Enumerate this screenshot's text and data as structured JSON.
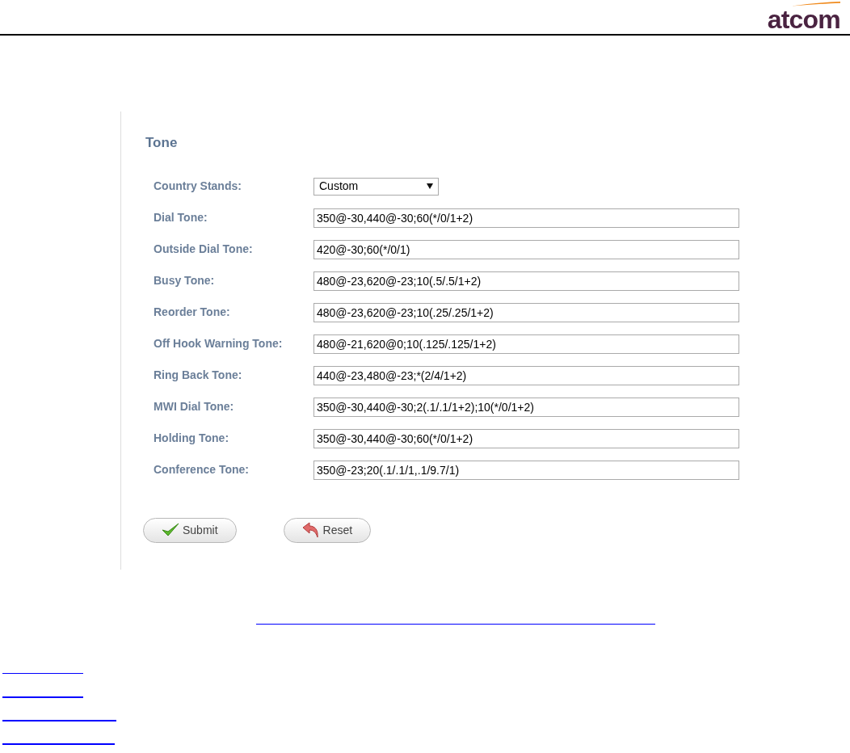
{
  "header": {
    "logo": "atcom"
  },
  "form": {
    "title": "Tone",
    "fields": [
      {
        "kind": "select",
        "label": "Country Stands:",
        "value": "Custom"
      },
      {
        "kind": "text",
        "label": "Dial Tone:",
        "value": "350@-30,440@-30;60(*/0/1+2)"
      },
      {
        "kind": "text",
        "label": "Outside Dial Tone:",
        "value": "420@-30;60(*/0/1)"
      },
      {
        "kind": "text",
        "label": "Busy Tone:",
        "value": "480@-23,620@-23;10(.5/.5/1+2)"
      },
      {
        "kind": "text",
        "label": "Reorder Tone:",
        "value": "480@-23,620@-23;10(.25/.25/1+2)"
      },
      {
        "kind": "text",
        "label": "Off Hook Warning Tone:",
        "value": "480@-21,620@0;10(.125/.125/1+2)"
      },
      {
        "kind": "text",
        "label": "Ring Back Tone:",
        "value": "440@-23,480@-23;*(2/4/1+2)"
      },
      {
        "kind": "text",
        "label": "MWI Dial Tone:",
        "value": "350@-30,440@-30;2(.1/.1/1+2);10(*/0/1+2)"
      },
      {
        "kind": "text",
        "label": "Holding Tone:",
        "value": "350@-30,440@-30;60(*/0/1+2)"
      },
      {
        "kind": "text",
        "label": "Conference Tone:",
        "value": "350@-23;20(.1/.1/1,.1/9.7/1)"
      }
    ],
    "buttons": [
      {
        "kind": "submit",
        "label": "Submit"
      },
      {
        "kind": "reset",
        "label": "Reset"
      }
    ]
  }
}
